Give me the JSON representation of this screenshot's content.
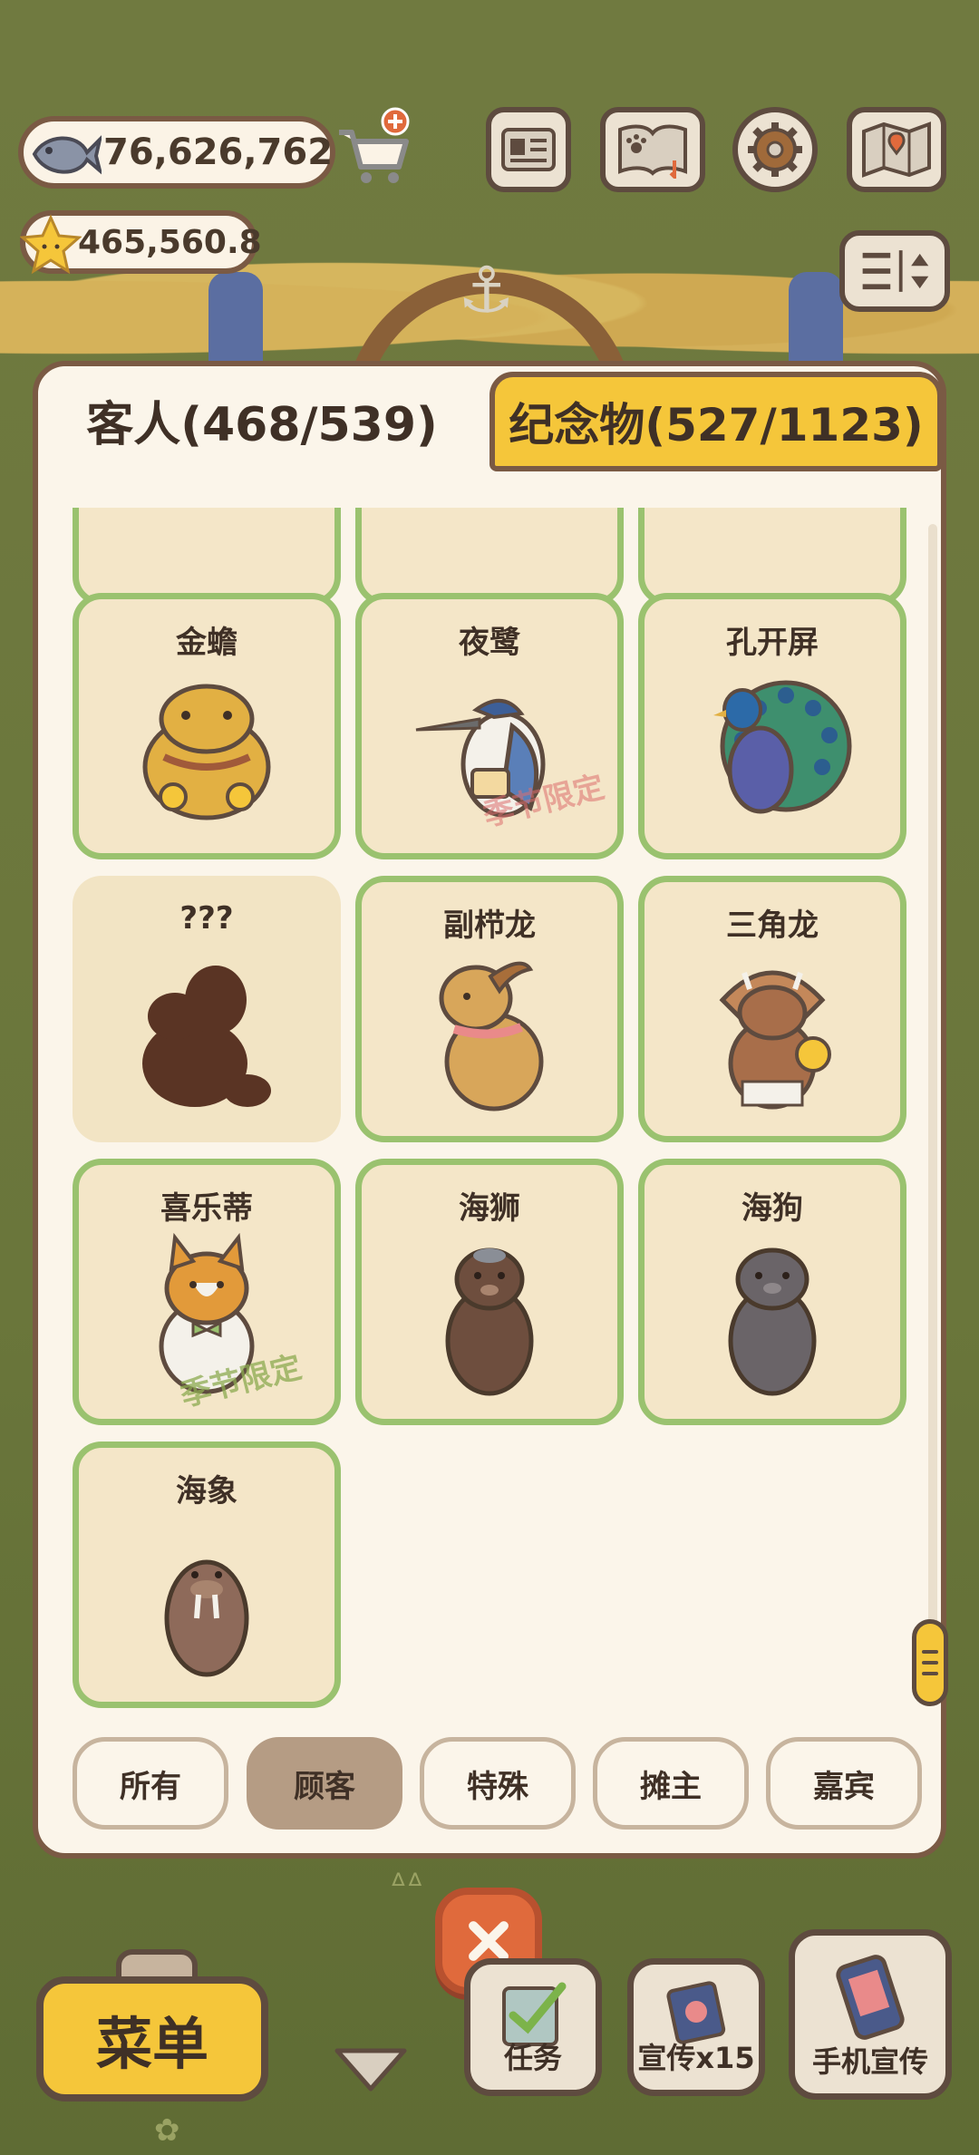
{
  "hud": {
    "fish_currency": "76,626,762",
    "star_currency": "465,560.8"
  },
  "tabs": [
    {
      "label": "客人(468/539)",
      "active": true
    },
    {
      "label": "纪念物(527/1123)",
      "active": false
    }
  ],
  "cards": [
    {
      "name": "金蟾",
      "icon": "golden-toad-icon",
      "season": ""
    },
    {
      "name": "夜鹭",
      "icon": "night-heron-icon",
      "season": "季节限定"
    },
    {
      "name": "孔开屏",
      "icon": "peacock-icon",
      "season": ""
    },
    {
      "name": "???",
      "icon": "locked-silhouette-icon",
      "season": ""
    },
    {
      "name": "副栉龙",
      "icon": "parasaurolophus-icon",
      "season": ""
    },
    {
      "name": "三角龙",
      "icon": "triceratops-icon",
      "season": ""
    },
    {
      "name": "喜乐蒂",
      "icon": "sheltie-icon",
      "season": "季节限定"
    },
    {
      "name": "海狮",
      "icon": "sea-lion-icon",
      "season": ""
    },
    {
      "name": "海狗",
      "icon": "fur-seal-icon",
      "season": ""
    },
    {
      "name": "海象",
      "icon": "walrus-icon",
      "season": ""
    }
  ],
  "filters": [
    {
      "label": "所有",
      "active": false
    },
    {
      "label": "顾客",
      "active": true
    },
    {
      "label": "特殊",
      "active": false
    },
    {
      "label": "摊主",
      "active": false
    },
    {
      "label": "嘉宾",
      "active": false
    }
  ],
  "bottom": {
    "menu_label": "菜单",
    "task_label": "任务",
    "promo_label": "宣传x15",
    "phone_promo_label": "手机宣传"
  },
  "colors": {
    "accent_yellow": "#f5c63a",
    "card_border_green": "#9ac26f",
    "frame_brown": "#7a5a44",
    "close_orange": "#e06a3c"
  }
}
